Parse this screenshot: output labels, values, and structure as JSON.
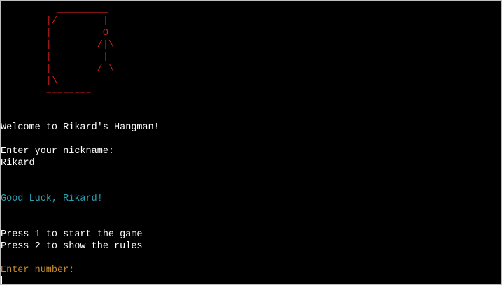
{
  "terminal": {
    "hangman_art": "          _________\n        |/        |\n        |         O\n        |        /|\\\n        |         |\n        |        / \\\n        |\\\n        ========",
    "welcome_message": "Welcome to Rikard's Hangman!",
    "nickname_prompt": "Enter your nickname:",
    "nickname_input": "Rikard",
    "good_luck_message": "Good Luck, Rikard!",
    "menu_option_1": "Press 1 to start the game",
    "menu_option_2": "Press 2 to show the rules",
    "number_prompt": "Enter number:"
  },
  "colors": {
    "background": "#000000",
    "text": "#ffffff",
    "art": "#cc1f1f",
    "good_luck": "#2aa1b3",
    "number_prompt": "#c58a2c"
  }
}
